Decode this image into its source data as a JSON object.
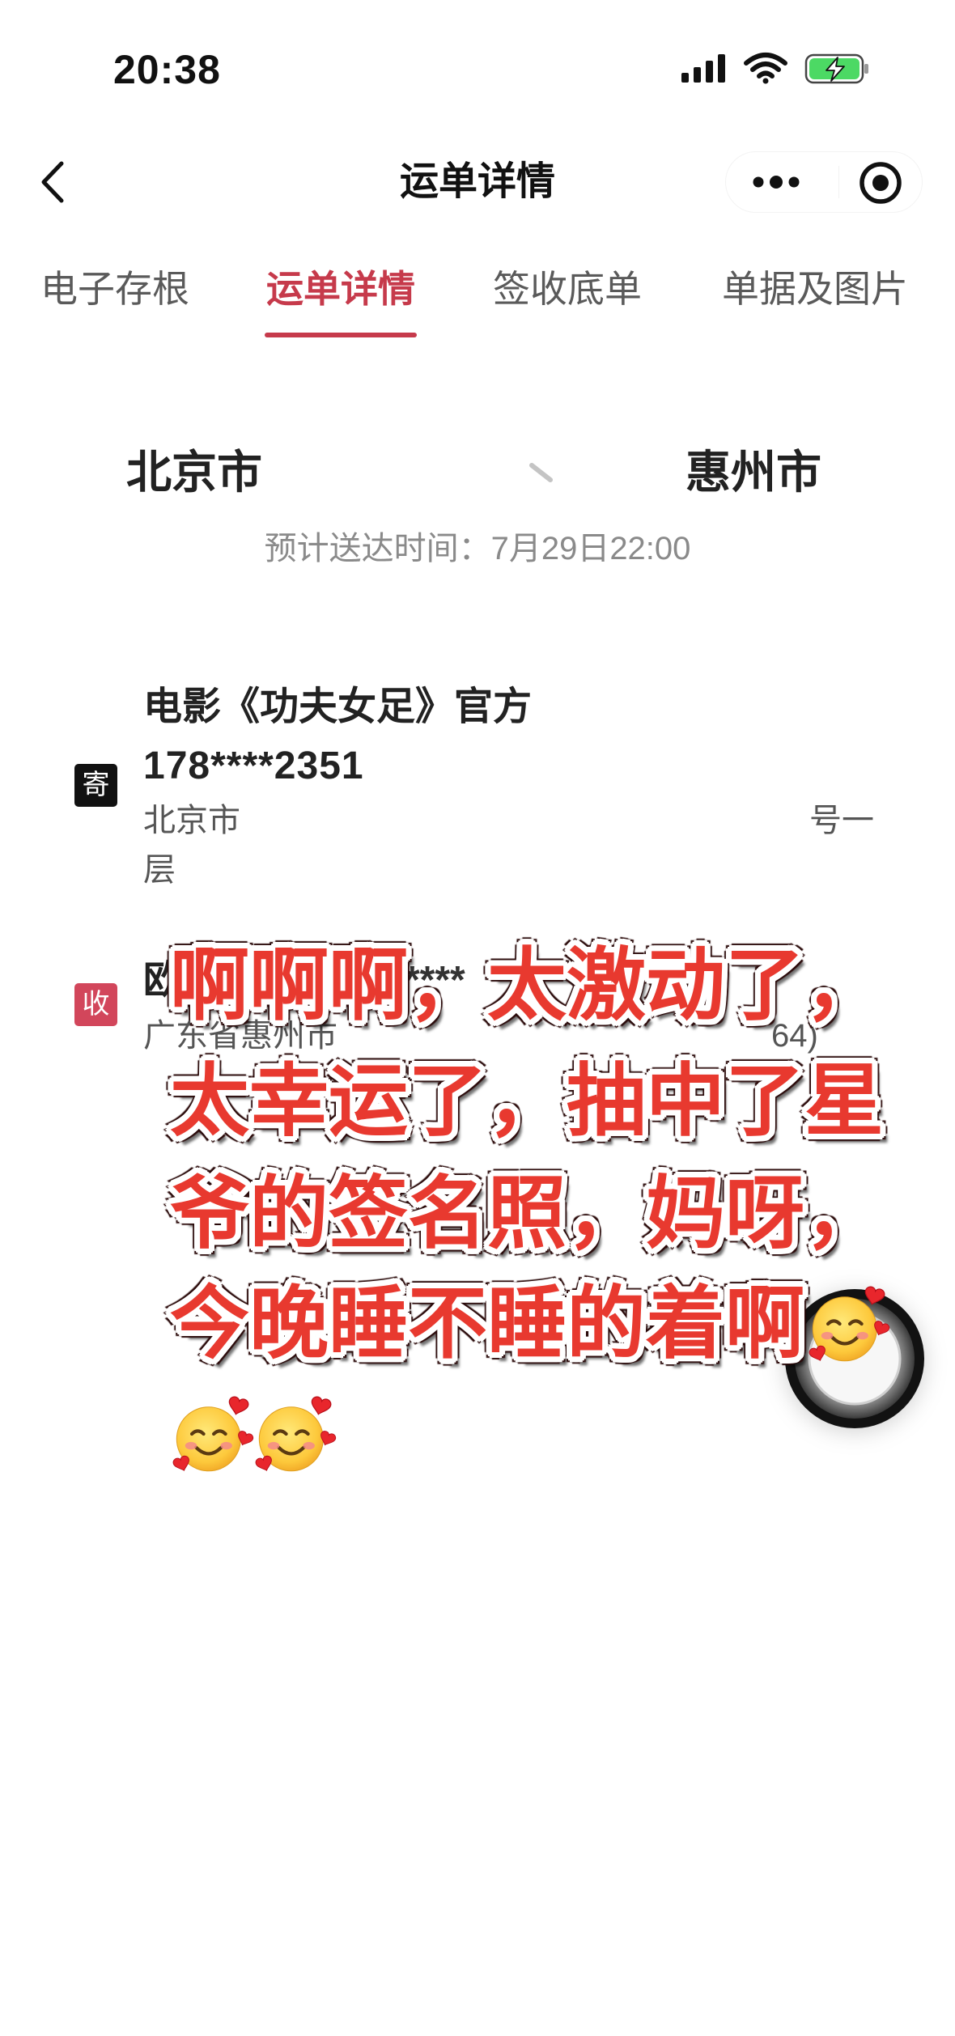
{
  "status_bar": {
    "time": "20:38",
    "icons": [
      "signal-icon",
      "wifi-icon",
      "battery-charging-icon"
    ]
  },
  "nav": {
    "title": "运单详情",
    "back_icon": "chevron-left-icon",
    "more_icon": "more-dots-icon",
    "close_icon": "record-target-icon"
  },
  "tabs": [
    {
      "label": "电子存根",
      "active": false
    },
    {
      "label": "运单详情",
      "active": true
    },
    {
      "label": "签收底单",
      "active": false
    },
    {
      "label": "单据及图片",
      "active": false
    }
  ],
  "route": {
    "from": "北京市",
    "to": "惠州市",
    "arrow_icon": "route-arrow-icon",
    "eta": "预计送达时间：7月29日22:00"
  },
  "sender": {
    "badge": "寄",
    "name": "电影《功夫女足》官方",
    "phone": "178****2351",
    "address_start": "北京市",
    "address_end": "号一",
    "address_line2": "层"
  },
  "receiver": {
    "badge": "收",
    "name_start": "欧",
    "name_masked": "****",
    "address_start": "广东省惠州市",
    "address_end": "64)"
  },
  "floating_button_icon": "floating-record-button-icon",
  "overlay": {
    "lines": [
      "啊啊啊，太激动了，",
      "太幸运了，抽中了星",
      "爷的签名照，妈呀，",
      "今晚睡不睡的着啊"
    ],
    "emoji_icon": "smiling-face-with-hearts-icon"
  },
  "colors": {
    "accent": "#c63a4b",
    "overlay_text": "#e8392f",
    "sender_badge": "#111111",
    "receiver_badge": "#d2465b"
  }
}
